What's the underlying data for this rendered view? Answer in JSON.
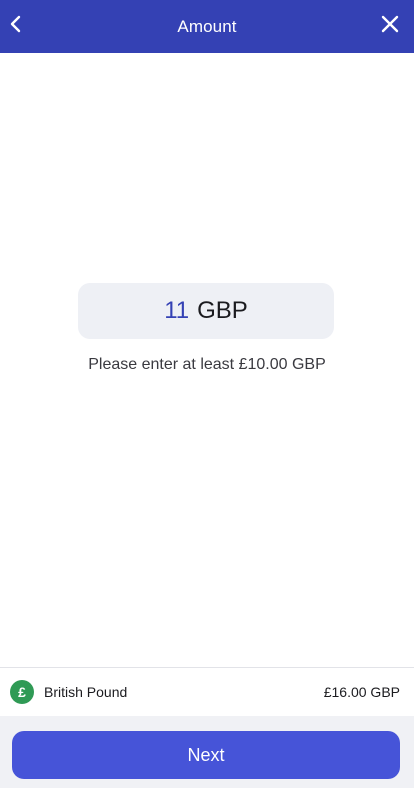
{
  "header": {
    "title": "Amount",
    "back_icon": "chevron-left-icon",
    "close_icon": "close-icon",
    "background": "#3441b4"
  },
  "amount": {
    "value": "11",
    "currency": "GBP",
    "value_color": "#3441b4"
  },
  "hint": "Please enter at least £10.00 GBP",
  "currency_row": {
    "icon": "pound-icon",
    "icon_symbol": "£",
    "icon_color": "#2f9a55",
    "name": "British Pound",
    "balance": "£16.00 GBP"
  },
  "footer": {
    "next_label": "Next",
    "button_color": "#4654d8"
  }
}
